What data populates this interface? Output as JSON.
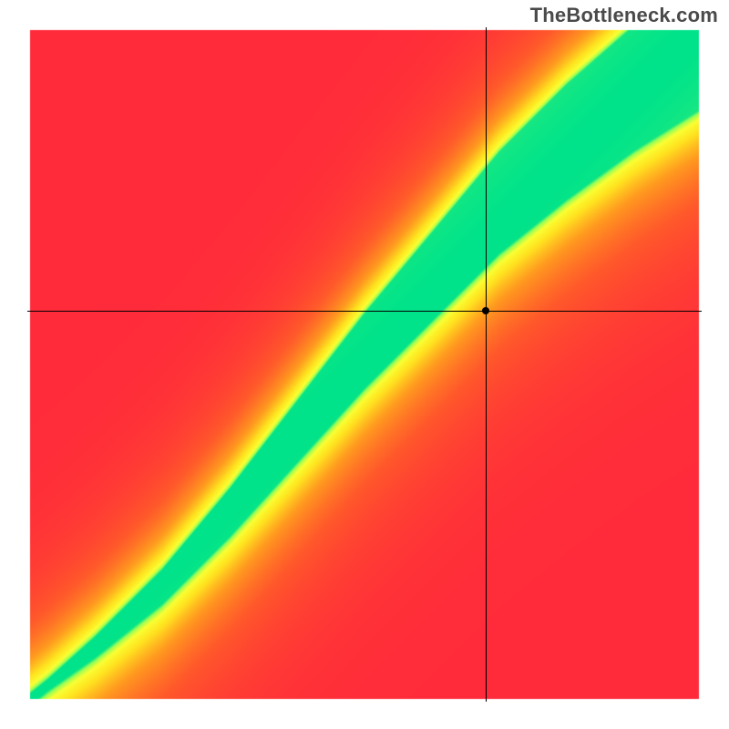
{
  "watermark": "TheBottleneck.com",
  "chart_data": {
    "type": "heatmap",
    "title": "",
    "xlabel": "",
    "ylabel": "",
    "xlim": [
      0,
      100
    ],
    "ylim": [
      0,
      100
    ],
    "color_scale": {
      "description": "Value 1.0 = optimal (green), 0.0 = worst (red); transitions through yellow/orange.",
      "stops": [
        {
          "value": 0.0,
          "color": "#ff2a3a"
        },
        {
          "value": 0.3,
          "color": "#ff5a2a"
        },
        {
          "value": 0.55,
          "color": "#ff9a1f"
        },
        {
          "value": 0.75,
          "color": "#ffe21f"
        },
        {
          "value": 0.88,
          "color": "#faff33"
        },
        {
          "value": 0.95,
          "color": "#9bff55"
        },
        {
          "value": 1.0,
          "color": "#00e38a"
        }
      ]
    },
    "optimal_ridge": {
      "description": "Approximate centerline of the green optimal band, as (x, y) pairs in axis units [0,100]. Curve is slightly super-linear (steepens with x).",
      "points": [
        [
          0,
          0
        ],
        [
          10,
          8
        ],
        [
          20,
          17
        ],
        [
          30,
          28
        ],
        [
          40,
          40
        ],
        [
          50,
          52
        ],
        [
          60,
          63
        ],
        [
          70,
          74
        ],
        [
          80,
          83
        ],
        [
          90,
          91
        ],
        [
          100,
          98
        ]
      ],
      "band_halfwidth_at_x": [
        [
          0,
          0.5
        ],
        [
          20,
          2.5
        ],
        [
          40,
          4.5
        ],
        [
          60,
          6.5
        ],
        [
          80,
          8.5
        ],
        [
          100,
          10.0
        ]
      ]
    },
    "crosshair": {
      "x": 68,
      "y": 58
    },
    "marker": {
      "x": 68,
      "y": 58
    },
    "grid": false,
    "legend": null
  }
}
